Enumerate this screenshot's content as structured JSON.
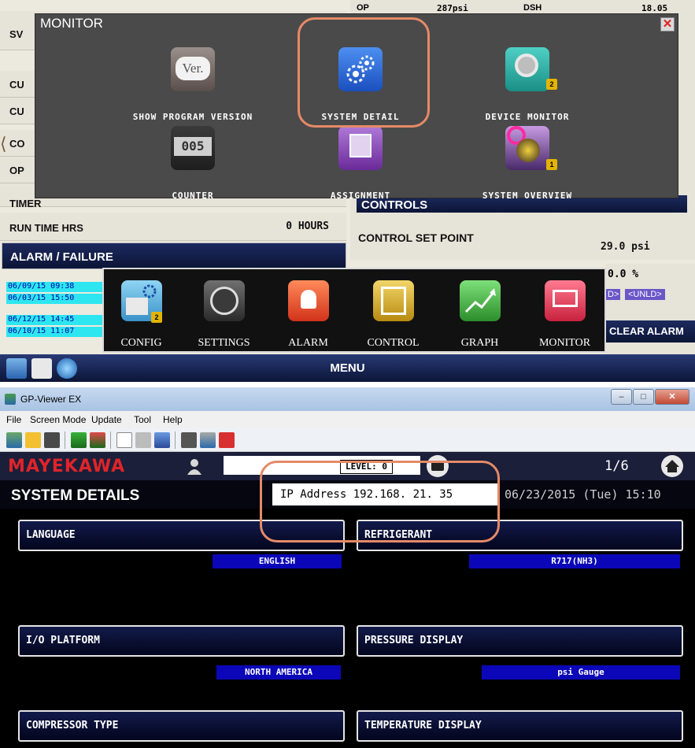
{
  "top_panel": {
    "bg_rows": [
      {
        "label": "SV",
        "value": ""
      },
      {
        "label": "CU",
        "value": ""
      },
      {
        "label": "CU",
        "value": ""
      },
      {
        "label": "CO",
        "value": ""
      },
      {
        "label": "OP",
        "value": ""
      },
      {
        "label": "TIMER",
        "value": ""
      },
      {
        "label": "RUN TIME HRS",
        "value": "0  HOURS"
      }
    ],
    "right_panel": {
      "top_left": "OP",
      "top_mid": "287psi",
      "top_col": "DSH",
      "top_right": "18.05",
      "controls_label": "CONTROLS",
      "control_set_point_label": "CONTROL SET POINT",
      "control_set_point_value": "29.0 psi",
      "pct_value": "0.0 %",
      "unld_left": "D>",
      "unld_right": "<UNLD>",
      "clear_alarm": "CLEAR ALARM"
    },
    "alarm_header": "ALARM / FAILURE",
    "alarm_times": [
      "06/09/15  09:38",
      "06/03/15  15:50",
      "06/12/15  14:45",
      "06/10/15  11:07"
    ],
    "monitor_dialog": {
      "title": "MONITOR",
      "items": [
        {
          "label": "SHOW PROGRAM VERSION",
          "icon": "version-icon",
          "icon_text": "Ver."
        },
        {
          "label": "SYSTEM DETAIL",
          "icon": "gears-icon"
        },
        {
          "label": "DEVICE MONITOR",
          "icon": "device-monitor-icon",
          "lock": "2"
        },
        {
          "label": "COUNTER",
          "icon": "counter-icon",
          "icon_text": "005"
        },
        {
          "label": "ASSIGNMENT",
          "icon": "assignment-icon"
        },
        {
          "label": "SYSTEM OVERVIEW",
          "icon": "system-overview-icon",
          "lock": "1"
        }
      ]
    },
    "menu_popup": {
      "items": [
        {
          "label": "CONFIG",
          "icon": "config-icon",
          "lock": "2"
        },
        {
          "label": "SETTINGS",
          "icon": "settings-icon"
        },
        {
          "label": "ALARM",
          "icon": "alarm-bell-icon"
        },
        {
          "label": "CONTROL",
          "icon": "control-icon"
        },
        {
          "label": "GRAPH",
          "icon": "graph-icon"
        },
        {
          "label": "MONITOR",
          "icon": "monitor-icon"
        }
      ]
    },
    "menu_bar_label": "MENU"
  },
  "viewer": {
    "window_title": "GP-Viewer EX",
    "menu": [
      "File",
      "Screen Mode",
      "Update",
      "Tool",
      "Help"
    ],
    "logo": "MAYEKAWA",
    "level_label": "LEVEL: 0",
    "page_indicator": "1/6",
    "page_title": "SYSTEM DETAILS",
    "ip_label": "IP Address",
    "ip_value": "192.168. 21. 35",
    "datetime": "06/23/2015 (Tue) 15:10",
    "sections": [
      {
        "label": "LANGUAGE",
        "value": "ENGLISH"
      },
      {
        "label": "REFRIGERANT",
        "value": "R717(NH3)"
      },
      {
        "label": "I/O PLATFORM",
        "value": "NORTH AMERICA"
      },
      {
        "label": "PRESSURE DISPLAY",
        "value": "psi Gauge"
      },
      {
        "label": "COMPRESSOR TYPE",
        "value": ""
      },
      {
        "label": "TEMPERATURE DISPLAY",
        "value": ""
      }
    ]
  },
  "colors": {
    "highlight": "#e58a68",
    "hmi_navy": "#0c1537",
    "value_blue": "#0b07b8",
    "logo_red": "#e0242a"
  }
}
